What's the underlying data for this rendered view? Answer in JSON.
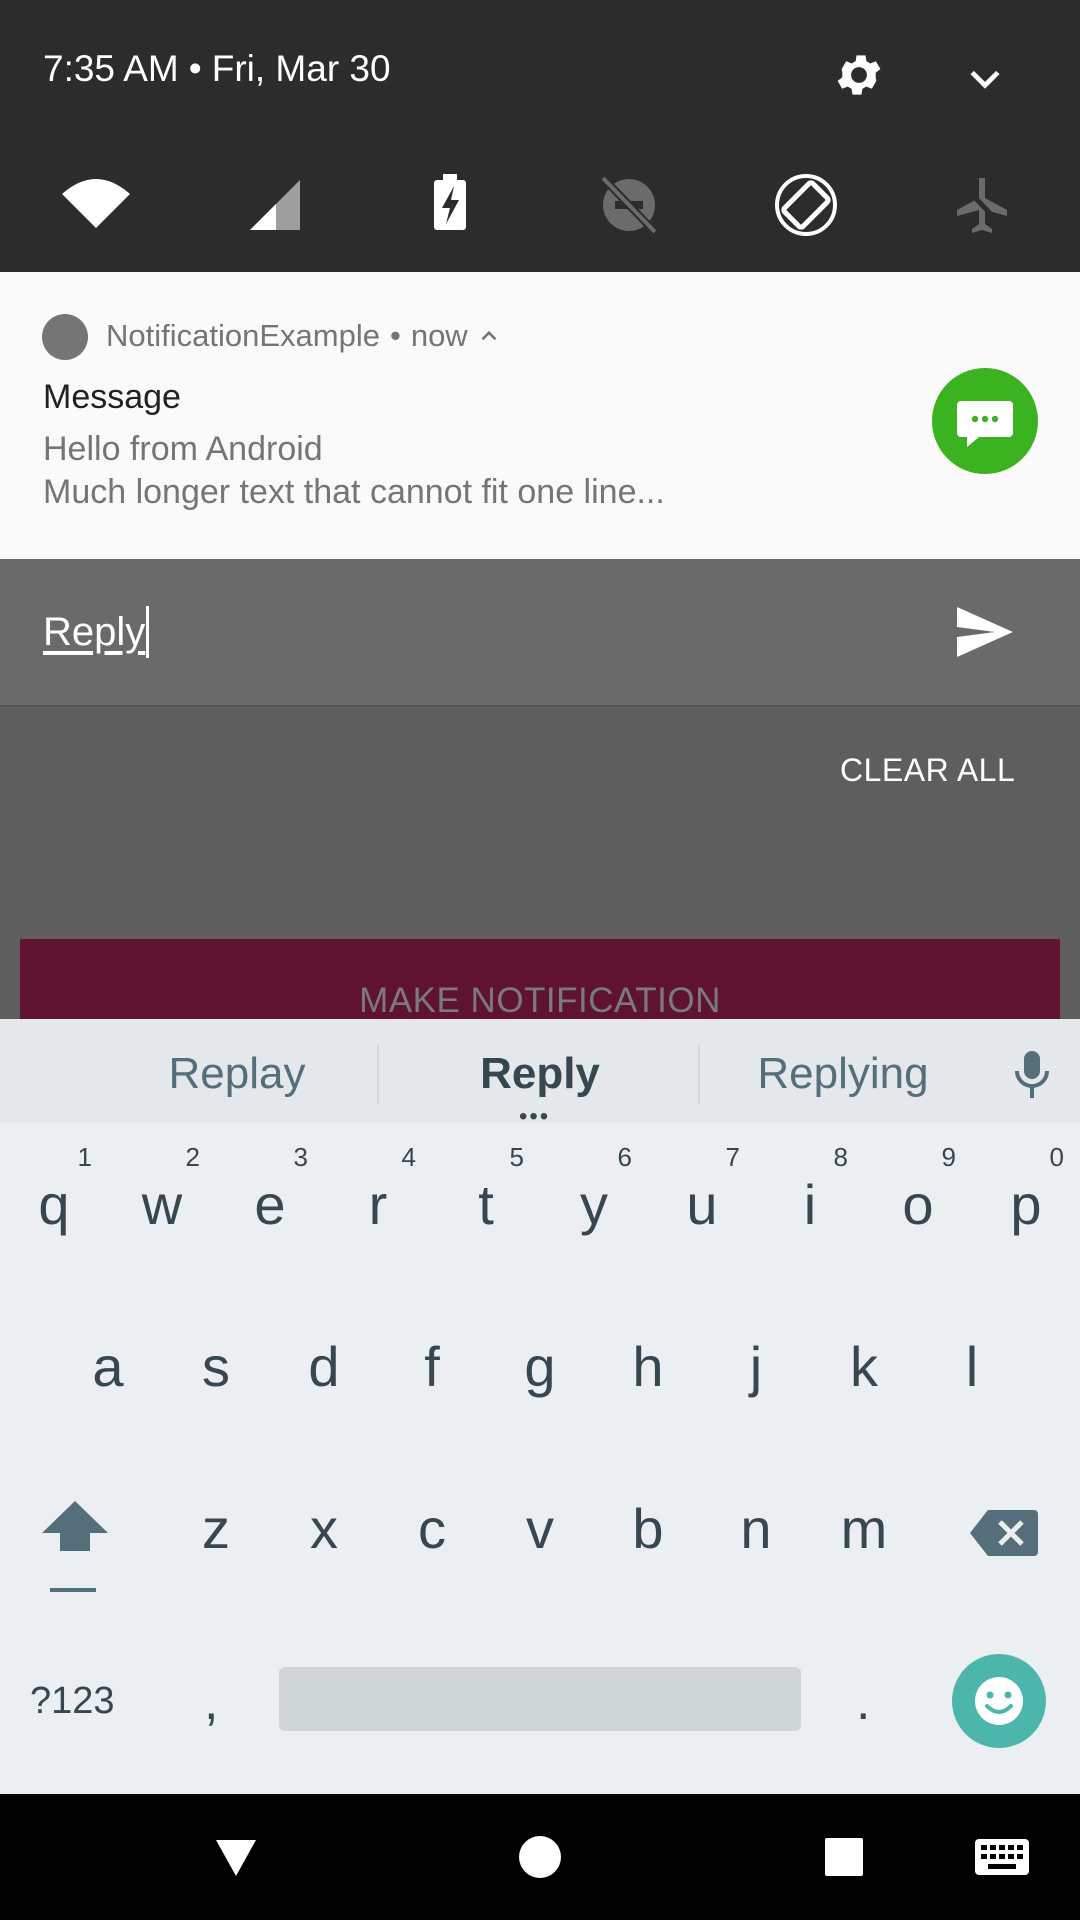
{
  "status": {
    "time": "7:35 AM",
    "separator": "•",
    "date": "Fri, Mar 30"
  },
  "quick_settings": {
    "tiles": [
      "wifi-icon",
      "cell-signal-icon",
      "battery-charging-icon",
      "do-not-disturb-off-icon",
      "auto-rotate-icon",
      "airplane-mode-icon"
    ]
  },
  "notification": {
    "app_name": "NotificationExample",
    "separator": "•",
    "time": "now",
    "title": "Message",
    "text_line1": "Hello from Android",
    "text_line2": "Much longer text that cannot fit one line...",
    "large_icon": "chat-bubble-icon",
    "large_icon_color": "#3bb21f"
  },
  "reply": {
    "value": "Reply"
  },
  "shade": {
    "clear_all": "CLEAR ALL"
  },
  "app": {
    "button_label": "MAKE NOTIFICATION",
    "button_color": "#5f1331"
  },
  "keyboard": {
    "suggestions": [
      "Replay",
      "Reply",
      "Replying"
    ],
    "suggestion_more": "•••",
    "row1": [
      {
        "k": "q",
        "h": "1"
      },
      {
        "k": "w",
        "h": "2"
      },
      {
        "k": "e",
        "h": "3"
      },
      {
        "k": "r",
        "h": "4"
      },
      {
        "k": "t",
        "h": "5"
      },
      {
        "k": "y",
        "h": "6"
      },
      {
        "k": "u",
        "h": "7"
      },
      {
        "k": "i",
        "h": "8"
      },
      {
        "k": "o",
        "h": "9"
      },
      {
        "k": "p",
        "h": "0"
      }
    ],
    "row2": [
      "a",
      "s",
      "d",
      "f",
      "g",
      "h",
      "j",
      "k",
      "l"
    ],
    "row3": [
      "z",
      "x",
      "c",
      "v",
      "b",
      "n",
      "m"
    ],
    "symbols": "?123",
    "comma": ",",
    "period": ".",
    "accent_color": "#4db6ac"
  },
  "nav": {
    "buttons": [
      "back-icon",
      "home-icon",
      "recents-icon",
      "keyboard-switch-icon"
    ]
  }
}
